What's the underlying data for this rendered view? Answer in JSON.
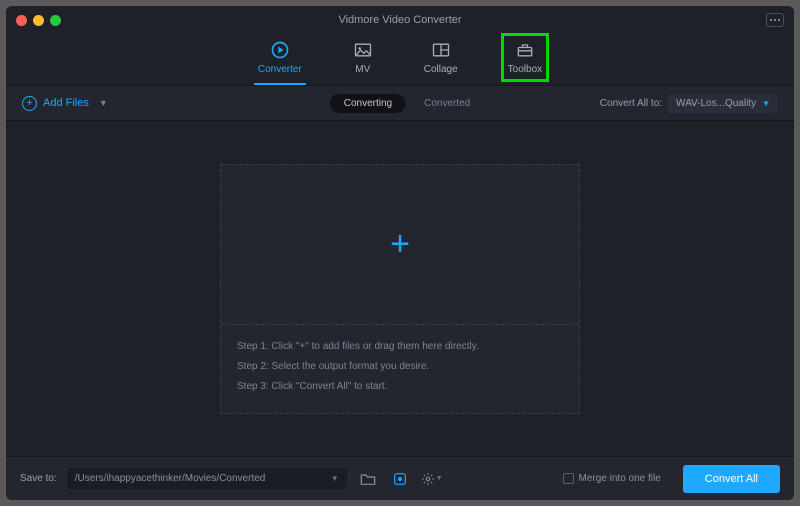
{
  "window": {
    "title": "Vidmore Video Converter"
  },
  "tabs": {
    "converter": "Converter",
    "mv": "MV",
    "collage": "Collage",
    "toolbox": "Toolbox"
  },
  "subbar": {
    "add_files": "Add Files",
    "converting": "Converting",
    "converted": "Converted",
    "convert_all_to_label": "Convert All to:",
    "format_value": "WAV-Los...Quality"
  },
  "dropzone": {
    "step1": "Step 1: Click \"+\" to add files or drag them here directly.",
    "step2": "Step 2: Select the output format you desire.",
    "step3": "Step 3: Click \"Convert All\" to start."
  },
  "footer": {
    "save_label": "Save to:",
    "save_path": "/Users/ihappyacethinker/Movies/Converted",
    "merge_label": "Merge into one file",
    "convert_button": "Convert All"
  }
}
